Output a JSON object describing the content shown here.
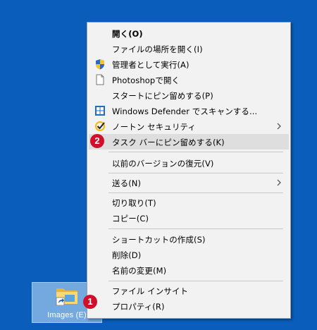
{
  "desktop": {
    "icon_label": "Images (E)"
  },
  "menu": {
    "items": [
      {
        "label": "開く(O)"
      },
      {
        "label": "ファイルの場所を開く(I)"
      },
      {
        "label": "管理者として実行(A)",
        "icon": "uac-shield-icon"
      },
      {
        "label": "Photoshopで開く",
        "icon": "blank-document-icon"
      },
      {
        "label": "スタートにピン留めする(P)"
      },
      {
        "label": "Windows Defender でスキャンする...",
        "icon": "windows-defender-icon"
      },
      {
        "label": "ノートン セキュリティ",
        "icon": "norton-check-icon"
      },
      {
        "label": "タスク バーにピン留めする(K)"
      },
      {
        "label": "以前のバージョンの復元(V)"
      },
      {
        "label": "送る(N)"
      },
      {
        "label": "切り取り(T)"
      },
      {
        "label": "コピー(C)"
      },
      {
        "label": "ショートカットの作成(S)"
      },
      {
        "label": "削除(D)"
      },
      {
        "label": "名前の変更(M)"
      },
      {
        "label": "ファイル インサイト"
      },
      {
        "label": "プロパティ(R)"
      }
    ]
  },
  "badges": {
    "step1": "1",
    "step2": "2"
  },
  "colors": {
    "desktop_background": "#0a5dba",
    "menu_background": "#f2f2f2",
    "highlight": "#dedede",
    "badge": "#d0102b"
  }
}
